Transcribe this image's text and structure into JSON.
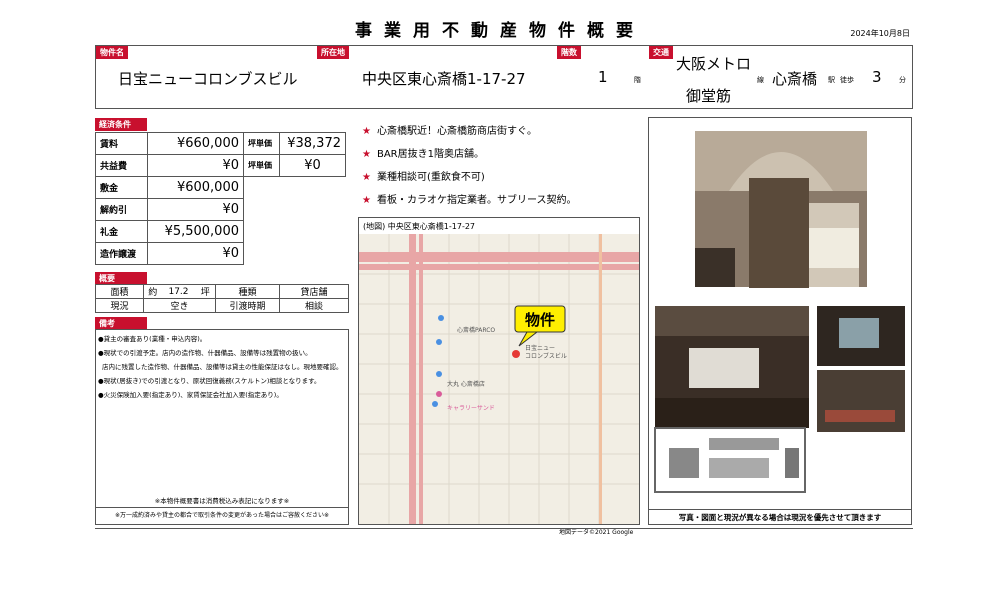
{
  "title": "事業用不動産物件概要",
  "date": "2024年10月8日",
  "header": {
    "property_name_label": "物件名",
    "property_name": "日宝ニューコロンブスビル",
    "location_label": "所在地",
    "location": "中央区東心斎橋1-17-27",
    "floor_label": "階数",
    "floor": "1",
    "floor_unit": "階",
    "transit_label": "交通",
    "line_name_1": "大阪メトロ",
    "line_name_2": "御堂筋",
    "line_unit": "線",
    "station": "心斎橋",
    "station_unit": "駅",
    "walk_label": "徒歩",
    "walk_minutes": "3",
    "minute_unit": "分"
  },
  "economics": {
    "label": "経済条件",
    "rent_label": "賃料",
    "rent": "¥660,000",
    "unit_price_label": "坪単価",
    "unit_price": "¥38,372",
    "common_fee_label": "共益費",
    "common_fee": "¥0",
    "common_unit_price_label": "坪単価",
    "common_unit_price": "¥0",
    "deposit_label": "敷金",
    "deposit": "¥600,000",
    "cancellation_label": "解約引",
    "cancellation": "¥0",
    "key_money_label": "礼金",
    "key_money": "¥5,500,000",
    "transfer_label": "造作譲渡",
    "transfer": "¥0"
  },
  "overview": {
    "label": "概要",
    "area_label": "面積",
    "area_prefix": "約",
    "area_value": "17.2",
    "area_unit": "坪",
    "type_label": "種類",
    "type_value": "貸店舗",
    "status_label": "現況",
    "status_value": "空き",
    "handover_label": "引渡時期",
    "handover_value": "相談"
  },
  "remarks": {
    "label": "備考",
    "lines": [
      "●貸主の審査あり(業種・申込内容)。",
      "●現状での引渡予定。店内の造作物、什器備品、設備等は残置物の扱い。",
      "店内に残置した造作物、什器備品、設備等は貸主の性能保証はなし。現地要確認。",
      "●現状(居抜き)での引渡となり、原状回復義務(スケルトン)相談となります。",
      "●火災保険加入要(指定あり)、家賃保証会社加入要(指定あり)。"
    ],
    "tax_note": "※本物件概要書は消費税込み表記になります※",
    "change_note": "※万一成約済みや貸主の都合で取引条件の変更があった場合はご容赦ください※"
  },
  "features": [
    "心斎橋駅近！心斎橋筋商店街すぐ。",
    "BAR居抜き1階奥店舗。",
    "業種相談可(重飲食不可)",
    "看板・カラオケ指定業者。サブリース契約。"
  ],
  "map": {
    "caption": "(地図) 中央区東心斎橋1-17-27",
    "pin_label": "物件",
    "building_label_1": "日宝ニュー",
    "building_label_2": "コロンブスビル",
    "poi_1": "心斎橋PARCO",
    "poi_2": "大丸 心斎橋店",
    "poi_3": "キャラリーサンド",
    "credit": "地図データ©2021 Google"
  },
  "photo_note": "写真・図面と現況が異なる場合は現況を優先させて頂きます",
  "colors": {
    "label_red": "#c8102e",
    "map_bg": "#f2eee4",
    "map_road": "#e8a6a6",
    "pin_yellow": "#ffef00"
  }
}
